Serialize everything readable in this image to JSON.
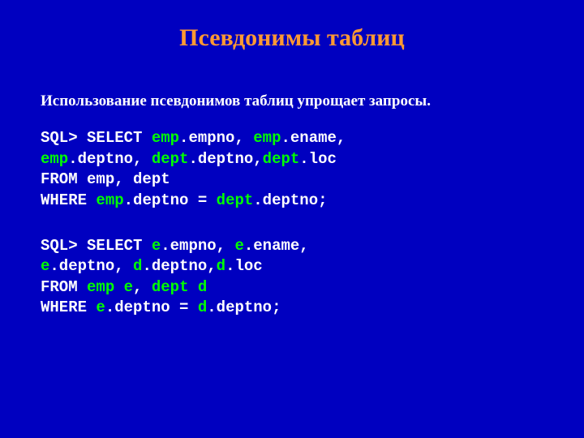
{
  "title": "Псевдонимы таблиц",
  "subtitle": "Использование псевдонимов таблиц упрощает запросы.",
  "code1": {
    "line1_prefix": "SQL> SELECT ",
    "emp1": "emp",
    "dot_empno": ".empno, ",
    "emp2": "emp",
    "dot_ename": ".ename,",
    "line2_emp": "emp",
    "line2_deptno": ".deptno, ",
    "line2_dept": "dept",
    "line2_deptno2": ".deptno,",
    "line2_dept2": "dept",
    "line2_loc": ".loc",
    "line3": "   FROM   emp, dept",
    "line4_prefix": "   WHERE  ",
    "line4_emp": "emp",
    "line4_mid": ".deptno = ",
    "line4_dept": "dept",
    "line4_end": ".deptno;"
  },
  "code2": {
    "line1_prefix": "SQL> SELECT  ",
    "e1": "e",
    "dot_empno": ".empno, ",
    "e2": "e",
    "dot_ename": ".ename,",
    "line2_e": "e",
    "line2_deptno": ".deptno, ",
    "line2_d": "d",
    "line2_deptno2": ".deptno,",
    "line2_d2": "d",
    "line2_loc": ".loc",
    "line3_prefix": "   FROM    ",
    "line3_emp": "emp",
    "line3_e": " e",
    "line3_comma": ", ",
    "line3_dept": "dept",
    "line3_d": " d",
    "line4_prefix": "   WHERE   ",
    "line4_e": "e",
    "line4_mid": ".deptno = ",
    "line4_d": "d",
    "line4_end": ".deptno;"
  }
}
